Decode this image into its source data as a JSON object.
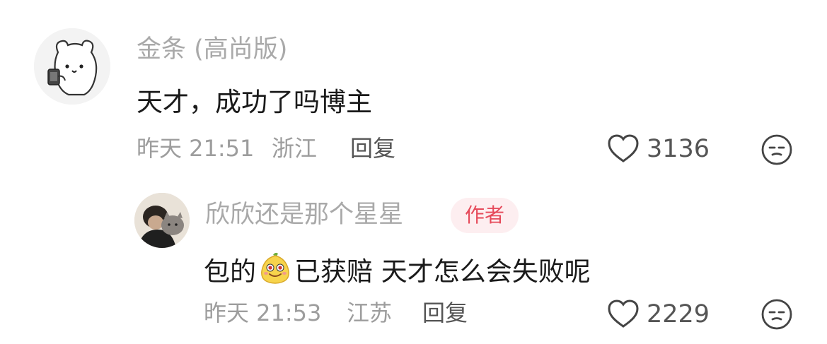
{
  "comment": {
    "username": "金条 (高尚版)",
    "text": "天才，成功了吗博主",
    "time": "昨天 21:51",
    "location": "浙江",
    "reply_label": "回复",
    "likes": "3136",
    "avatar_icon": "bear-holding-phone-avatar"
  },
  "reply": {
    "username": "欣欣还是那个星星",
    "badge": "作者",
    "text_before": "包的",
    "emoji_name": "smug-pear-emoji",
    "text_after": "已获赔 天才怎么会失败呢",
    "time": "昨天 21:53",
    "location": "江苏",
    "reply_label": "回复",
    "likes": "2229",
    "avatar_icon": "person-with-cat-avatar"
  },
  "colors": {
    "username": "#a9a9a9",
    "text": "#1a1a1a",
    "meta": "#9d9d9d",
    "badge_bg": "#fdeef0",
    "badge_text": "#e64a5a"
  }
}
